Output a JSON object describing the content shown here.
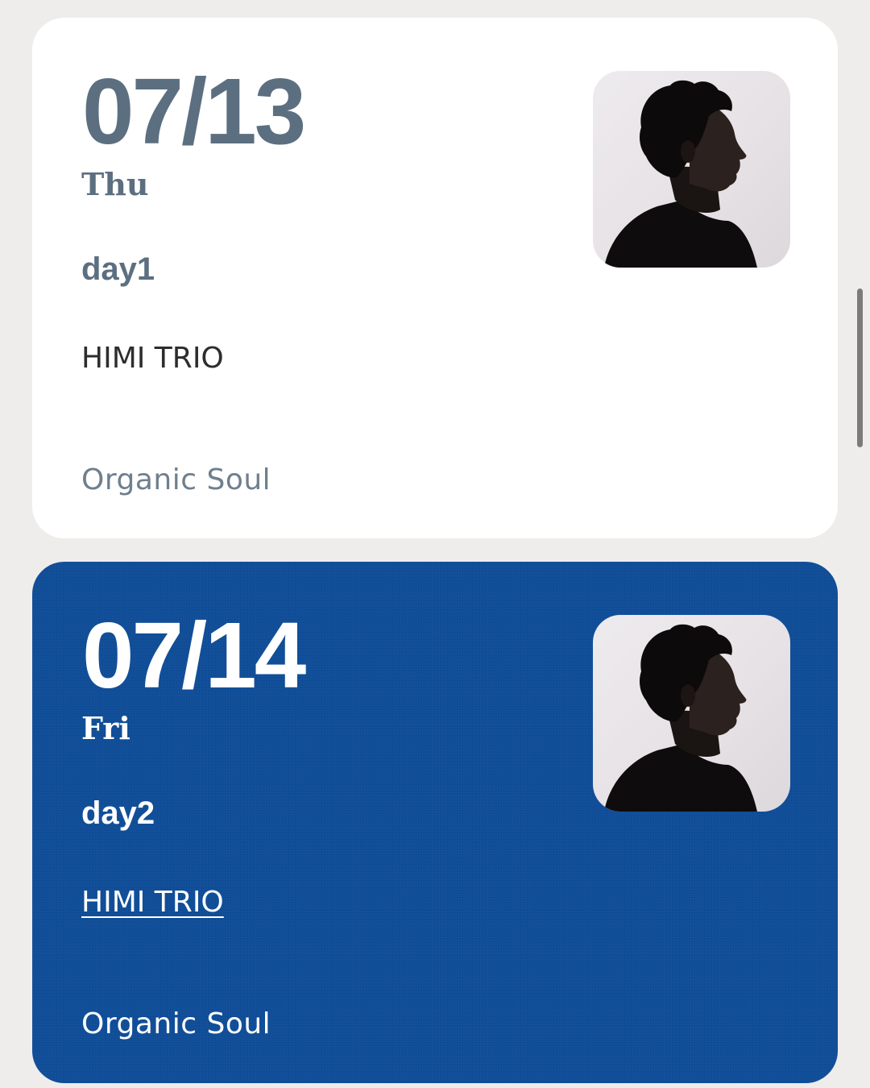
{
  "events": [
    {
      "date": "07/13",
      "weekday": "Thu",
      "day_label": "day1",
      "artist": "HIMI TRIO",
      "genre": "Organic Soul",
      "card_color": "#ffffff",
      "text_color": "#5c6f81",
      "artist_is_link": false
    },
    {
      "date": "07/14",
      "weekday": "Fri",
      "day_label": "day2",
      "artist": "HIMI TRIO",
      "genre": "Organic Soul",
      "card_color": "#0f4d98",
      "text_color": "#ffffff",
      "artist_is_link": true
    }
  ],
  "avatar_icon": "artist-portrait-silhouette",
  "page_background": "#efedeb"
}
